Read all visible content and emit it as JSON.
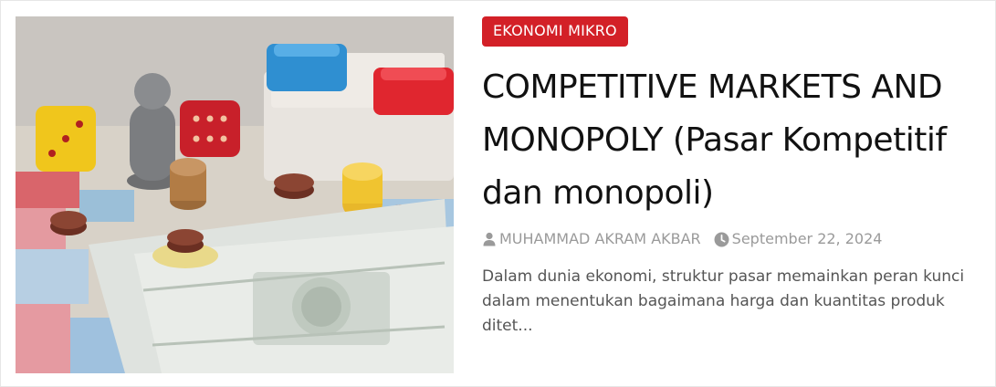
{
  "post": {
    "category": "EKONOMI MIKRO",
    "title": "COMPETITIVE MARKETS AND MONOPOLY (Pasar Kompetitif dan monopoli)",
    "author": "MUHAMMAD AKRAM AKBAR",
    "date": "September 22, 2024",
    "excerpt": "Dalam dunia ekonomi, struktur pasar memainkan peran kunci dalam menentukan bagaimana harga dan kuantitas produk ditet..."
  },
  "icons": {
    "author": "user-icon",
    "date": "clock-icon"
  },
  "colors": {
    "category_bg": "#d32027",
    "title": "#111111",
    "meta": "#9a9a9a",
    "excerpt": "#555555"
  }
}
